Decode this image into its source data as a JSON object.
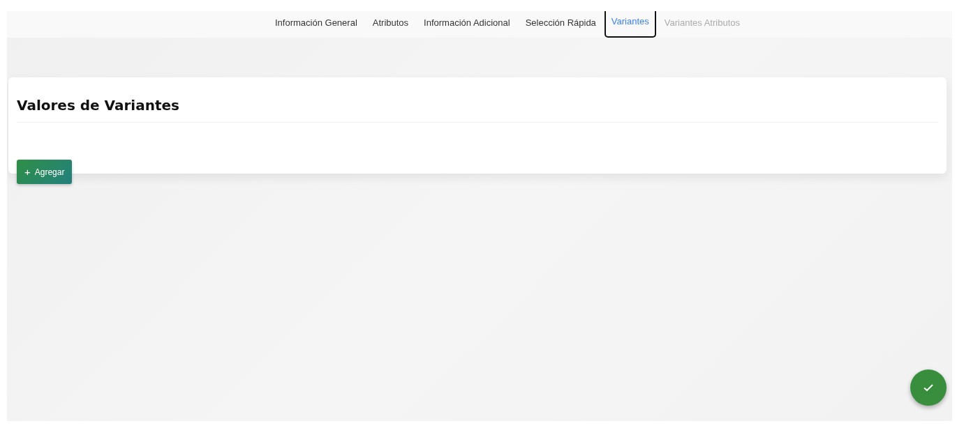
{
  "tabs": [
    {
      "label": "Información General",
      "selected": false,
      "disabled": false
    },
    {
      "label": "Atributos",
      "selected": false,
      "disabled": false
    },
    {
      "label": "Información Adicional",
      "selected": false,
      "disabled": false
    },
    {
      "label": "Selección Rápida",
      "selected": false,
      "disabled": false
    },
    {
      "label": "Variantes",
      "selected": true,
      "disabled": false
    },
    {
      "label": "Variantes Atributos",
      "selected": false,
      "disabled": true
    }
  ],
  "card": {
    "title": "Valores de Variantes",
    "add_button": {
      "icon": "+",
      "label": "Agregar"
    }
  }
}
